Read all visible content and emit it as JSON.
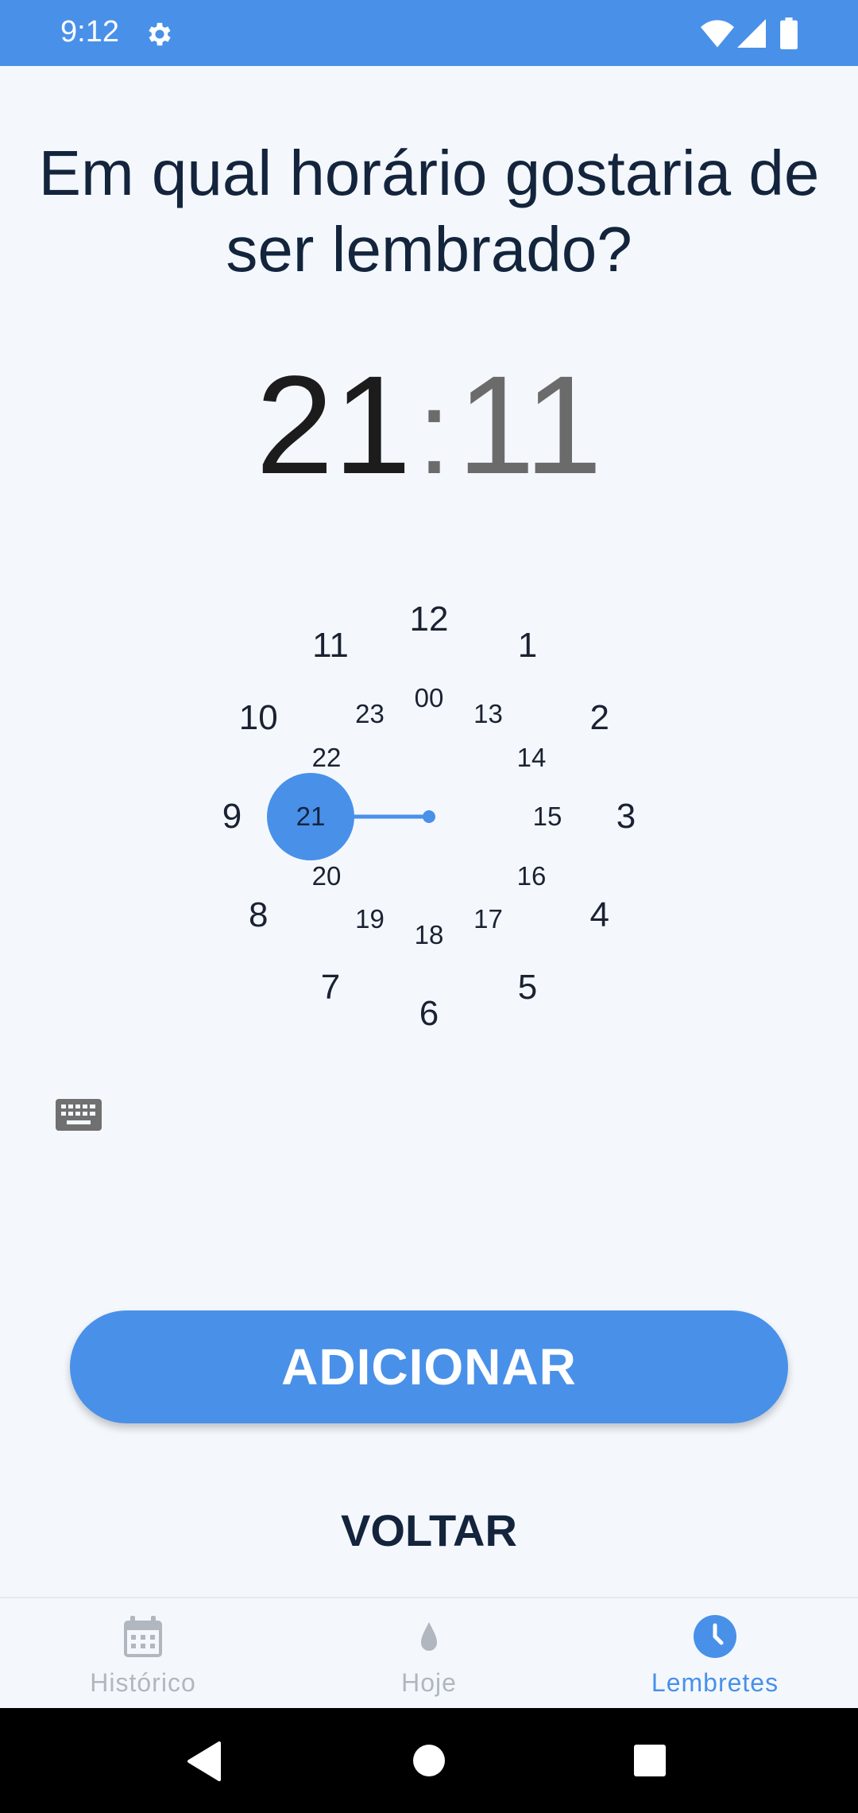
{
  "status_bar": {
    "time": "9:12",
    "icons": [
      "gear-icon",
      "wifi-icon",
      "signal-icon",
      "battery-icon"
    ]
  },
  "question": {
    "line1": "Em qual horário gostaria de",
    "line2": "ser lembrado?"
  },
  "time_display": {
    "hour": "21",
    "separator": ":",
    "minute": "11"
  },
  "clock": {
    "outer": [
      "12",
      "1",
      "2",
      "3",
      "4",
      "5",
      "6",
      "7",
      "8",
      "9",
      "10",
      "11"
    ],
    "inner": [
      "00",
      "13",
      "14",
      "15",
      "16",
      "17",
      "18",
      "19",
      "20",
      "21",
      "22",
      "23"
    ],
    "selected": "21",
    "accent_color": "#4990e9"
  },
  "keyboard_toggle": {
    "icon": "keyboard-icon"
  },
  "actions": {
    "add_label": "ADICIONAR",
    "back_label": "VOLTAR"
  },
  "bottom_nav": {
    "items": [
      {
        "label": "Histórico",
        "icon": "calendar-icon",
        "active": false
      },
      {
        "label": "Hoje",
        "icon": "water-drop-icon",
        "active": false
      },
      {
        "label": "Lembretes",
        "icon": "clock-icon",
        "active": true
      }
    ]
  },
  "colors": {
    "primary": "#4990e9",
    "background": "#f4f8fd",
    "text_dark": "#13243c",
    "nav_inactive": "#b1b7be"
  }
}
